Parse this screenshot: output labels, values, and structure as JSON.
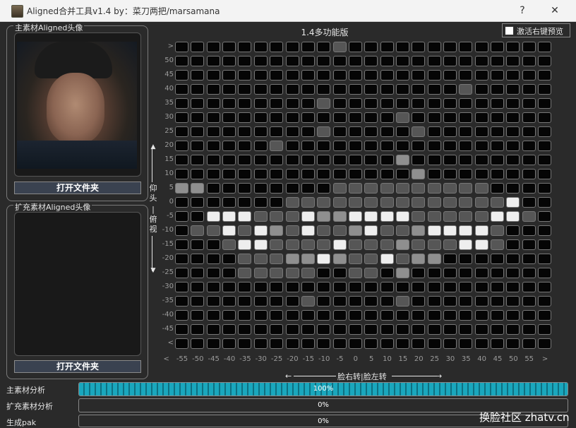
{
  "window": {
    "title": "Aligned合并工具v1.4  by：菜刀两把/marsamana",
    "help_label": "?",
    "close_label": "✕"
  },
  "main_panel": {
    "label": "主素材Aligned头像",
    "open_button": "打开文件夹"
  },
  "ext_panel": {
    "label": "扩充素材Aligned头像",
    "open_button": "打开文件夹"
  },
  "grid": {
    "title": "1.4多功能版",
    "preview_checkbox": {
      "label": "激活右键预览",
      "checked": false
    },
    "y_labels": [
      ">",
      "50",
      "45",
      "40",
      "35",
      "30",
      "25",
      "20",
      "15",
      "10",
      "5",
      "0",
      "-5",
      "-10",
      "-15",
      "-20",
      "-25",
      "-30",
      "-35",
      "-40",
      "-45",
      "<"
    ],
    "x_labels": [
      "<",
      "-55",
      "-50",
      "-45",
      "-40",
      "-35",
      "-30",
      "-25",
      "-20",
      "-15",
      "-10",
      "-5",
      "0",
      "5",
      "10",
      "15",
      "20",
      "25",
      "30",
      "35",
      "40",
      "45",
      "50",
      "55",
      ">"
    ],
    "vertical_axis": {
      "up": "仰头",
      "sep": "|",
      "down": "俯视"
    },
    "horizontal_axis": "脸右转|脸左转",
    "rows": [
      "000000000010000000000000",
      "000000000000000000000000",
      "000000000000000000000000",
      "000000000000000000100000",
      "000000000100000000000000",
      "000000000000001000000000",
      "000000000100000100000000",
      "000000100000000000000000",
      "000000000000002000000000",
      "000000000000000200000000",
      "220000000011111111110000",
      "000000011111111111111300",
      "003331113223333111113310",
      "011313213112311233331000",
      "000133111131112111331000",
      "000011122321131220000000",
      "000011111001102000000000",
      "000000000000000000000000",
      "000000001000001000000000",
      "000000000000000000000000",
      "000000000000000000000000",
      "000000000000000000000000"
    ],
    "palette": [
      "#050505",
      "#565656",
      "#8f8f8f",
      "#eeeeee"
    ]
  },
  "progress": [
    {
      "label": "主素材分析",
      "value": 100,
      "text": "100%"
    },
    {
      "label": "扩充素材分析",
      "value": 0,
      "text": "0%"
    },
    {
      "label": "生成pak",
      "value": 0,
      "text": "0%"
    }
  ],
  "watermark": "换脸社区 zhatv.cn"
}
